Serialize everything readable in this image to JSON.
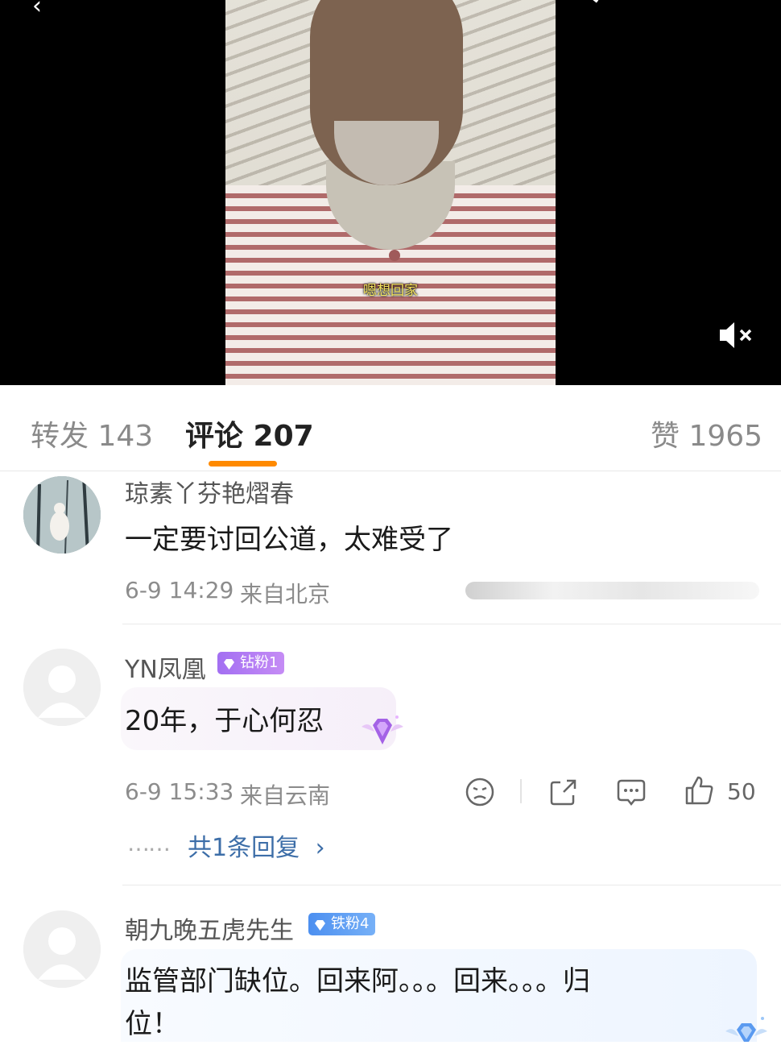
{
  "video": {
    "subtitle": "嗯想回家",
    "back_icon": "back-arrow-icon",
    "search_icon": "search-icon",
    "close_icon": "close-icon",
    "mute_icon": "volume-muted-icon"
  },
  "tabs": [
    {
      "label": "转发 143"
    },
    {
      "label": "评论 207",
      "active": true
    },
    {
      "label": "赞 1965"
    }
  ],
  "colors": {
    "accent": "#ff8a00",
    "diamond_badge": "#9a6cf0",
    "iron_badge": "#5a9af0"
  },
  "comments": [
    {
      "user": "琼素丫芬艳熠春",
      "text": "一定要讨回公道，太难受了",
      "time": "6-9 14:29",
      "location": "来自北京"
    },
    {
      "user": "YN凤凰",
      "badge": "钻粉1",
      "text": "20年，于心何忍",
      "time": "6-9 15:33",
      "location": "来自云南",
      "likes": "50",
      "replies": "共1条回复"
    },
    {
      "user": "朝九晚五虎先生",
      "badge": "铁粉4",
      "text_line1": "监管部门缺位。回来阿。。。回来。。。归",
      "text_line2": "位！"
    }
  ],
  "dots": "……"
}
